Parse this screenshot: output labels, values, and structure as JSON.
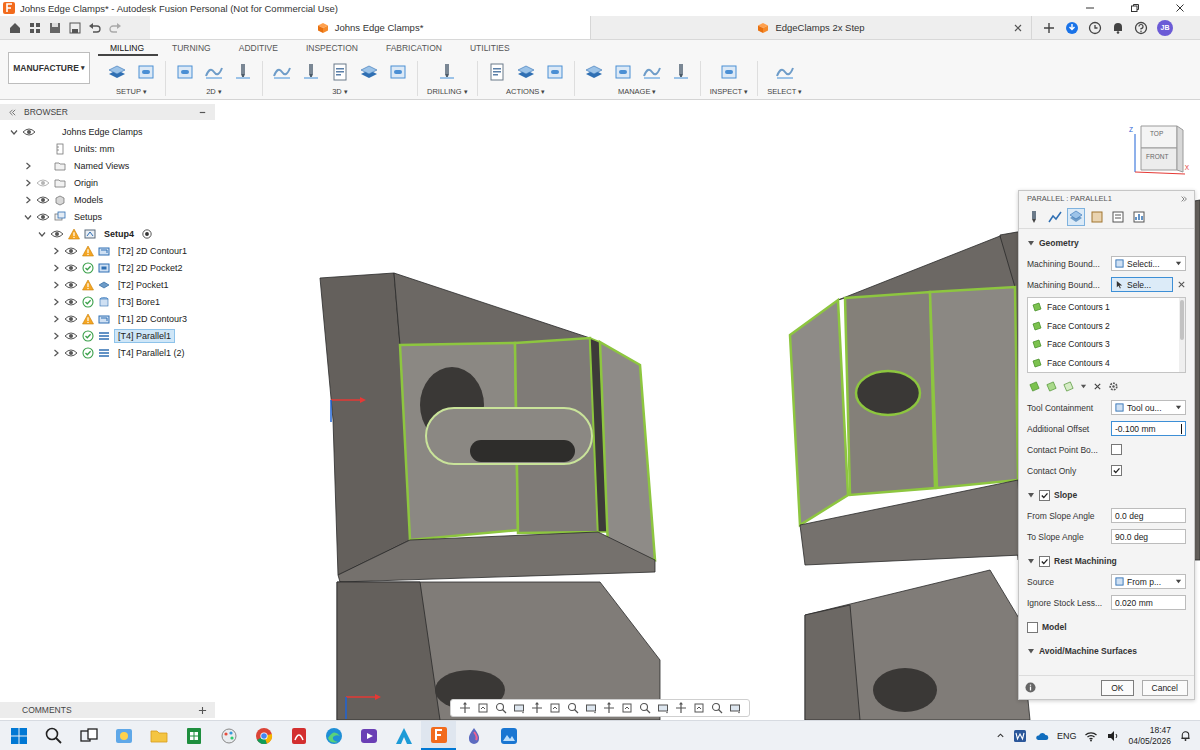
{
  "window": {
    "title": "Johns Edge Clamps* - Autodesk Fusion Personal (Not for Commercial Use)"
  },
  "document_tabs": [
    {
      "label": "Johns Edge Clamps*",
      "selected": true
    },
    {
      "label": "EdgeClamps 2x Step",
      "selected": false
    }
  ],
  "user": {
    "initials": "JB"
  },
  "workspace": {
    "label": "MANUFACTURE",
    "caret": "▾"
  },
  "ribbon_tabs": [
    {
      "label": "MILLING",
      "selected": true
    },
    {
      "label": "TURNING",
      "selected": false
    },
    {
      "label": "ADDITIVE",
      "selected": false
    },
    {
      "label": "INSPECTION",
      "selected": false
    },
    {
      "label": "FABRICATION",
      "selected": false
    },
    {
      "label": "UTILITIES",
      "selected": false
    }
  ],
  "ribbon_groups": [
    {
      "label": "SETUP",
      "caret": "▾"
    },
    {
      "label": "2D",
      "caret": "▾"
    },
    {
      "label": "3D",
      "caret": "▾"
    },
    {
      "label": "DRILLING",
      "caret": "▾"
    },
    {
      "label": "ACTIONS",
      "caret": "▾"
    },
    {
      "label": "MANAGE",
      "caret": "▾"
    },
    {
      "label": "INSPECT",
      "caret": "▾"
    },
    {
      "label": "SELECT",
      "caret": "▾"
    }
  ],
  "browser": {
    "title": "BROWSER",
    "items": [
      {
        "label": "Johns Edge Clamps",
        "level": 0,
        "kind": "document",
        "expandable": true,
        "expanded": true,
        "eye": "shown",
        "status": "none",
        "selected": false,
        "active": false
      },
      {
        "label": "Units: mm",
        "level": 1,
        "kind": "units",
        "expandable": false,
        "expanded": false,
        "eye": "none",
        "status": "none",
        "selected": false,
        "active": false
      },
      {
        "label": "Named Views",
        "level": 1,
        "kind": "folder",
        "expandable": true,
        "expanded": false,
        "eye": "none",
        "status": "none",
        "selected": false,
        "active": false
      },
      {
        "label": "Origin",
        "level": 1,
        "kind": "folder",
        "expandable": true,
        "expanded": false,
        "eye": "hidden",
        "status": "none",
        "selected": false,
        "active": false
      },
      {
        "label": "Models",
        "level": 1,
        "kind": "models",
        "expandable": true,
        "expanded": false,
        "eye": "shown",
        "status": "none",
        "selected": false,
        "active": false
      },
      {
        "label": "Setups",
        "level": 1,
        "kind": "setups",
        "expandable": true,
        "expanded": true,
        "eye": "shown",
        "status": "none",
        "selected": false,
        "active": false
      },
      {
        "label": "Setup4",
        "level": 2,
        "kind": "setup",
        "expandable": true,
        "expanded": true,
        "eye": "shown",
        "status": "warning",
        "selected": false,
        "active": true
      },
      {
        "label": "[T2] 2D Contour1",
        "level": 3,
        "kind": "contour2d",
        "expandable": true,
        "expanded": false,
        "eye": "shown",
        "status": "warning",
        "selected": false,
        "active": false
      },
      {
        "label": "[T2] 2D Pocket2",
        "level": 3,
        "kind": "pocket2d",
        "expandable": true,
        "expanded": false,
        "eye": "shown",
        "status": "ok",
        "selected": false,
        "active": false
      },
      {
        "label": "[T2] Pocket1",
        "level": 3,
        "kind": "pocket3d",
        "expandable": true,
        "expanded": false,
        "eye": "shown",
        "status": "warning",
        "selected": false,
        "active": false
      },
      {
        "label": "[T3] Bore1",
        "level": 3,
        "kind": "bore",
        "expandable": true,
        "expanded": false,
        "eye": "shown",
        "status": "ok",
        "selected": false,
        "active": false
      },
      {
        "label": "[T1] 2D Contour3",
        "level": 3,
        "kind": "contour2d",
        "expandable": true,
        "expanded": false,
        "eye": "shown",
        "status": "warning",
        "selected": false,
        "active": false
      },
      {
        "label": "[T4] Parallel1",
        "level": 3,
        "kind": "parallel",
        "expandable": true,
        "expanded": false,
        "eye": "shown",
        "status": "ok",
        "selected": true,
        "active": false
      },
      {
        "label": "[T4] Parallel1 (2)",
        "level": 3,
        "kind": "parallel",
        "expandable": true,
        "expanded": false,
        "eye": "shown",
        "status": "ok",
        "selected": false,
        "active": false
      }
    ]
  },
  "comments": {
    "title": "COMMENTS"
  },
  "view_cube": {
    "top": "TOP",
    "front": "FRONT",
    "z": "Z",
    "x": "X"
  },
  "dialog": {
    "title": "PARALLEL : PARALLEL1",
    "tabs": [
      {
        "selected": false
      },
      {
        "selected": false
      },
      {
        "selected": true
      },
      {
        "selected": false
      },
      {
        "selected": false
      },
      {
        "selected": false
      }
    ],
    "sections": [
      {
        "title": "Geometry",
        "has_arrow": true,
        "has_checkbox": false,
        "expanded": true,
        "rows": [
          {
            "kind": "dropdown",
            "label": "Machining Bound...",
            "value": "Selecti..."
          },
          {
            "kind": "select",
            "label": "Machining Bound...",
            "value": "Sele...",
            "active": true
          },
          {
            "kind": "list",
            "items": [
              "Face Contours 1",
              "Face Contours 2",
              "Face Contours 3",
              "Face Contours 4"
            ]
          },
          {
            "kind": "toolbar"
          },
          {
            "kind": "dropdown",
            "label": "Tool Containment",
            "value": "Tool ou..."
          },
          {
            "kind": "input",
            "label": "Additional Offset",
            "value": "-0.100 mm",
            "focused": true
          },
          {
            "kind": "checkbox",
            "label": "Contact Point Bo...",
            "checked": false
          },
          {
            "kind": "checkbox",
            "label": "Contact Only",
            "checked": true
          }
        ]
      },
      {
        "title": "Slope",
        "has_arrow": true,
        "has_checkbox": true,
        "checked": true,
        "expanded": true,
        "rows": [
          {
            "kind": "input",
            "label": "From Slope Angle",
            "value": "0.0 deg",
            "focused": false
          },
          {
            "kind": "input",
            "label": "To Slope Angle",
            "value": "90.0 deg",
            "focused": false
          }
        ]
      },
      {
        "title": "Rest Machining",
        "has_arrow": true,
        "has_checkbox": true,
        "checked": true,
        "expanded": true,
        "rows": [
          {
            "kind": "dropdown",
            "label": "Source",
            "value": "From p..."
          },
          {
            "kind": "input",
            "label": "Ignore Stock Less...",
            "value": "0.020 mm",
            "focused": false
          }
        ]
      },
      {
        "title": "Model",
        "has_arrow": false,
        "has_checkbox": true,
        "checked": false,
        "expanded": false,
        "rows": []
      },
      {
        "title": "Avoid/Machine Surfaces",
        "has_arrow": true,
        "has_checkbox": false,
        "expanded": true,
        "rows": []
      }
    ],
    "buttons": [
      {
        "label": "OK",
        "kind": "primary"
      },
      {
        "label": "Cancel",
        "kind": "secondary"
      }
    ]
  },
  "taskbar": {
    "apps": [
      {
        "kind": "start",
        "selected": false
      },
      {
        "kind": "search",
        "selected": false
      },
      {
        "kind": "taskview",
        "selected": false
      },
      {
        "kind": "widget",
        "selected": false
      },
      {
        "kind": "files",
        "selected": false
      },
      {
        "kind": "sheets",
        "selected": false
      },
      {
        "kind": "paint",
        "selected": false
      },
      {
        "kind": "chrome",
        "selected": false
      },
      {
        "kind": "pdf",
        "selected": false
      },
      {
        "kind": "edge",
        "selected": false
      },
      {
        "kind": "media",
        "selected": false
      },
      {
        "kind": "autodesk",
        "selected": false
      },
      {
        "kind": "fusion",
        "selected": true
      },
      {
        "kind": "drop",
        "selected": false
      },
      {
        "kind": "photo",
        "selected": false
      }
    ],
    "lang": "ENG",
    "time": "18:47",
    "date": "04/05/2026"
  }
}
